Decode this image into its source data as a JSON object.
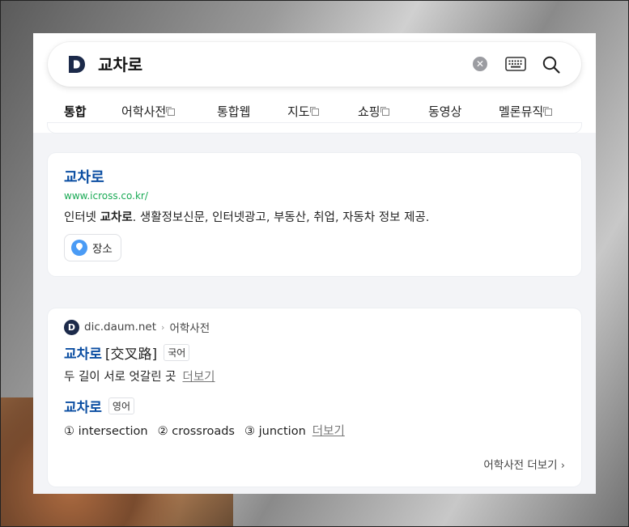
{
  "search": {
    "query": "교차로",
    "clear_icon": "close-circle-icon",
    "keyboard_icon": "keyboard-icon",
    "search_icon": "magnifier-icon"
  },
  "tabs": [
    {
      "label": "통합",
      "external": false,
      "active": true
    },
    {
      "label": "어학사전",
      "external": true
    },
    {
      "label": "통합웹",
      "external": false
    },
    {
      "label": "지도",
      "external": true
    },
    {
      "label": "쇼핑",
      "external": true
    },
    {
      "label": "동영상",
      "external": false
    },
    {
      "label": "멜론뮤직",
      "external": true
    }
  ],
  "result1": {
    "title": "교차로",
    "url": "www.icross.co.kr/",
    "desc_highlight": "교차로",
    "desc_prefix": "인터넷 ",
    "desc_suffix": ". 생활정보신문, 인터넷광고, 부동산, 취업, 자동차 정보 제공.",
    "chip_label": "장소"
  },
  "dictionary": {
    "source_domain": "dic.daum.net",
    "source_section": "어학사전",
    "entry_ko": {
      "word": "교차로",
      "hanja": "[交叉路]",
      "tag": "국어",
      "definition": "두 길이 서로 엇갈린 곳",
      "more": "더보기"
    },
    "entry_en": {
      "word": "교차로",
      "tag": "영어",
      "meanings": [
        "① intersection",
        "② crossroads",
        "③ junction"
      ],
      "more": "더보기"
    },
    "footer_more": "어학사전 더보기"
  }
}
